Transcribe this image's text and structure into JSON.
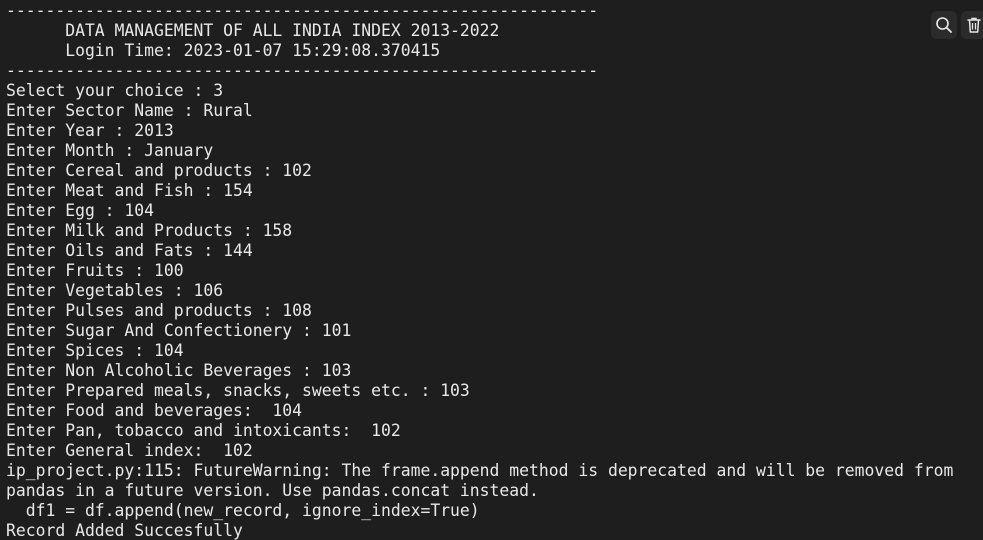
{
  "terminal": {
    "lines": [
      "------------------------------------------------------------",
      "      DATA MANAGEMENT OF ALL INDIA INDEX 2013-2022",
      "      Login Time: 2023-01-07 15:29:08.370415",
      "------------------------------------------------------------",
      "Select your choice : 3",
      "Enter Sector Name : Rural",
      "Enter Year : 2013",
      "Enter Month : January",
      "Enter Cereal and products : 102",
      "Enter Meat and Fish : 154",
      "Enter Egg : 104",
      "Enter Milk and Products : 158",
      "Enter Oils and Fats : 144",
      "Enter Fruits : 100",
      "Enter Vegetables : 106",
      "Enter Pulses and products : 108",
      "Enter Sugar And Confectionery : 101",
      "Enter Spices : 104",
      "Enter Non Alcoholic Beverages : 103",
      "Enter Prepared meals, snacks, sweets etc. : 103",
      "Enter Food and beverages:  104",
      "Enter Pan, tobacco and intoxicants:  102",
      "Enter General index:  102",
      "ip_project.py:115: FutureWarning: The frame.append method is deprecated and will be removed from",
      "pandas in a future version. Use pandas.concat instead.",
      "  df1 = df.append(new_record, ignore_index=True)",
      "Record Added Succesfully"
    ]
  },
  "toolbar": {
    "icons": [
      "search-icon",
      "trash-icon"
    ]
  },
  "colors": {
    "background": "#1e1e1e",
    "text": "#e8e8e8"
  }
}
